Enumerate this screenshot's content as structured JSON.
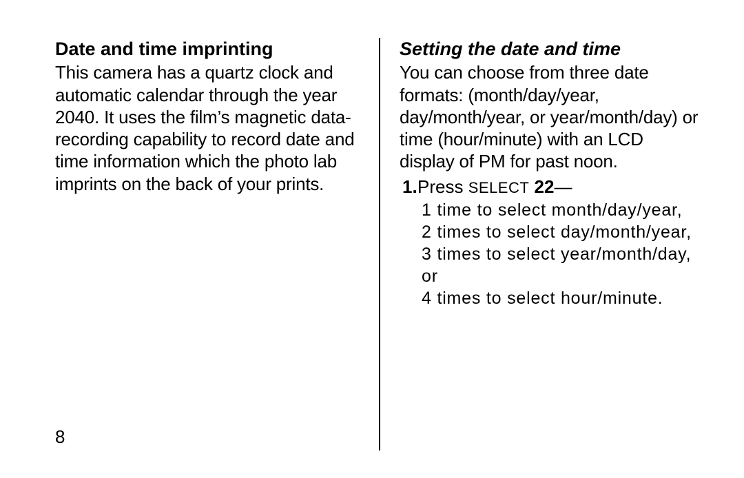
{
  "page_number": "8",
  "left": {
    "heading": "Date and time imprinting",
    "body": "This camera has a quartz clock and automatic calendar through the year 2040. It uses the film’s magnetic data-recording capability to record date and time information which the photo lab imprints on the back of your prints."
  },
  "right": {
    "heading": "Setting the date and time",
    "body": "You can choose from three date formats: (month/day/year, day/month/year, or year/month/day) or time (hour/minute) with an LCD display of PM for past noon.",
    "step_marker": "1.",
    "step_lead_press": "Press ",
    "step_lead_select": "SELECT",
    "step_lead_num": " 22",
    "step_lead_dash": "—",
    "sub1": "1 time to select month/day/year,",
    "sub2": "2 times to select day/month/year,",
    "sub3": "3 times to select year/month/day, or",
    "sub4": "4 times to select hour/minute."
  }
}
